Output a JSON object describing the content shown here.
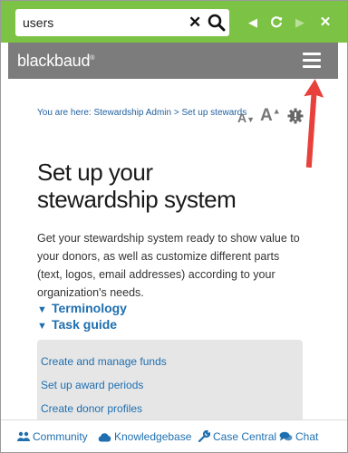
{
  "search": {
    "value": "users"
  },
  "brand": {
    "logo_text": "blackbaud"
  },
  "breadcrumb": {
    "prefix": "You are here:",
    "item1": "Stewardship Admin",
    "separator": ">",
    "item2": "Set up stewardship"
  },
  "tools": {
    "decrease_label": "A",
    "increase_label": "A"
  },
  "page": {
    "title_line1": "Set up your",
    "title_line2": "stewardship system",
    "intro": "Get your stewardship system ready to show value to your donors, as well as customize different parts (text, logos, email addresses) according to your organization's needs."
  },
  "sections": {
    "terminology": "Terminology",
    "task_guide": "Task guide"
  },
  "task_guide_links": [
    "Create and manage funds",
    "Set up award periods",
    "Create donor profiles"
  ],
  "footer": {
    "community": "Community",
    "knowledgebase": "Knowledgebase",
    "case_central": "Case Central",
    "chat": "Chat"
  },
  "colors": {
    "topbar": "#7cc244",
    "brandbar": "#7c7c7c",
    "link": "#1f6fb0",
    "arrow": "#e8413c"
  }
}
